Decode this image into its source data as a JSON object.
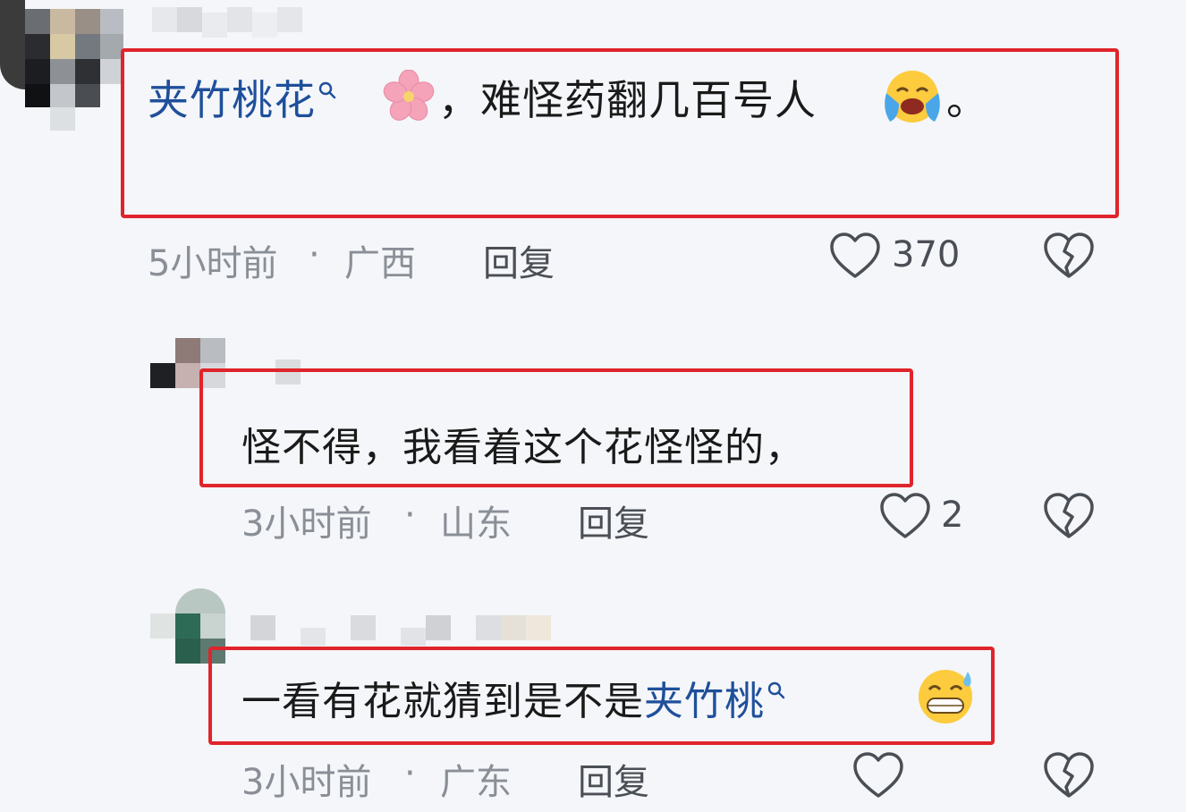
{
  "comments": [
    {
      "link_text": "夹竹桃花",
      "flower_icon": "cherry-blossom-icon",
      "body_text": "，难怪药翻几百号人",
      "emoji_icon": "loudly-crying-face-icon",
      "end_punct": "。",
      "time": "5小时前",
      "dot": "·",
      "location": "广西",
      "reply_label": "回复",
      "like_count": "370"
    },
    {
      "body_text": "怪不得，我看着这个花怪怪的，",
      "time": "3小时前",
      "dot": "·",
      "location": "山东",
      "reply_label": "回复",
      "like_count": "2"
    },
    {
      "body_text": "一看有花就猜到是不是",
      "link_text": "夹竹桃",
      "emoji_icon": "grinning-sweat-face-icon",
      "time": "3小时前",
      "dot": "·",
      "location": "广东",
      "reply_label": "回复",
      "like_count": ""
    }
  ],
  "colors": {
    "highlight": "#e0242b",
    "link": "#1f4f9b",
    "meta": "#8a8f97",
    "background": "#f4f6f9"
  }
}
